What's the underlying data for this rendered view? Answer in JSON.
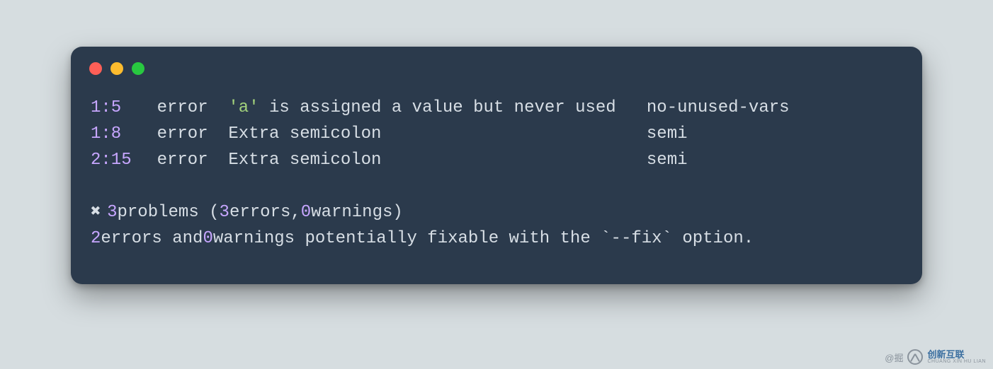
{
  "window": {
    "traffic": {
      "red": "close",
      "yellow": "minimize",
      "green": "zoom"
    }
  },
  "lint": {
    "rows": [
      {
        "loc": "1:5",
        "severity": "error",
        "quoted": "'a'",
        "msg_rest": " is assigned a value but never used",
        "rule": "no-unused-vars"
      },
      {
        "loc": "1:8",
        "severity": "error",
        "quoted": "",
        "msg_rest": "Extra semicolon",
        "rule": "semi"
      },
      {
        "loc": "2:15",
        "severity": "error",
        "quoted": "",
        "msg_rest": "Extra semicolon",
        "rule": "semi"
      }
    ],
    "summary": {
      "cross": "✖",
      "problems_count": "3",
      "problems_word": " problems (",
      "errors_count": "3",
      "errors_word": " errors, ",
      "warnings_count": "0",
      "warnings_word": " warnings)"
    },
    "fixable": {
      "errors": "2",
      "mid1": " errors and ",
      "warnings": "0",
      "mid2": " warnings potentially fixable with the `--fix` option."
    }
  },
  "watermark": {
    "prefix": "@掘",
    "brand_cn": "创新互联",
    "brand_en": "CHUANG XIN HU LIAN"
  }
}
